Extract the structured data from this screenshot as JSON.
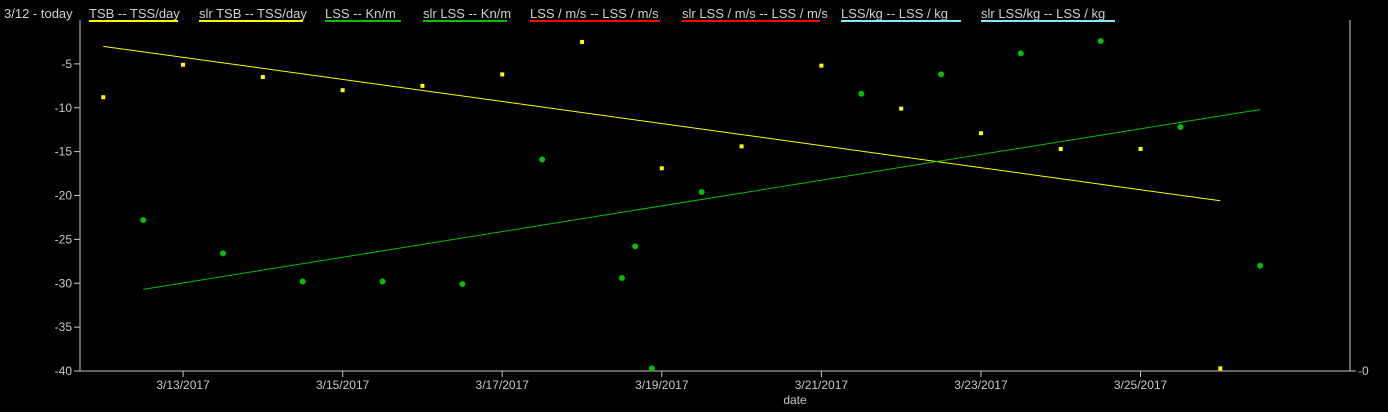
{
  "header": {
    "title": "3/12 - today"
  },
  "legend": [
    {
      "label": "TSB  -- TSS/day",
      "color": "#ffff00"
    },
    {
      "label": "slr TSB  -- TSS/day",
      "color": "#ffff00"
    },
    {
      "label": "LSS  -- Kn/m",
      "color": "#00c000"
    },
    {
      "label": "slr LSS  -- Kn/m",
      "color": "#00c000"
    },
    {
      "label": "LSS / m/s  -- LSS / m/s",
      "color": "#ff0000"
    },
    {
      "label": "slr LSS / m/s  -- LSS / m/s",
      "color": "#ff0000"
    },
    {
      "label": "LSS/kg  -- LSS / kg",
      "color": "#80e8ff"
    },
    {
      "label": "slr LSS/kg  -- LSS / kg",
      "color": "#80e8ff"
    }
  ],
  "chart_data": {
    "type": "scatter",
    "xlabel": "date",
    "ylabel": "",
    "ylim": [
      -40,
      0
    ],
    "xlim": [
      "2017-03-11T17:00",
      "2017-03-27T15:00"
    ],
    "y_ticks": [
      "-5",
      "-10",
      "-15",
      "-20",
      "-25",
      "-30",
      "-35",
      "-40"
    ],
    "right_tick": "-0",
    "x_ticks": [
      "3/13/2017",
      "3/15/2017",
      "3/17/2017",
      "3/19/2017",
      "3/21/2017",
      "3/23/2017",
      "3/25/2017"
    ],
    "series": [
      {
        "name": "TSB  -- TSS/day",
        "color": "#ffff00",
        "marker": "square",
        "points": [
          [
            "2017-03-12T00:00",
            -8.8
          ],
          [
            "2017-03-13T00:00",
            -5.1
          ],
          [
            "2017-03-14T00:00",
            -6.5
          ],
          [
            "2017-03-15T00:00",
            -8.0
          ],
          [
            "2017-03-16T00:00",
            -7.5
          ],
          [
            "2017-03-17T00:00",
            -6.2
          ],
          [
            "2017-03-18T00:00",
            -2.5
          ],
          [
            "2017-03-19T00:00",
            -16.9
          ],
          [
            "2017-03-20T00:00",
            -14.4
          ],
          [
            "2017-03-21T00:00",
            -5.2
          ],
          [
            "2017-03-22T00:00",
            -10.1
          ],
          [
            "2017-03-23T00:00",
            -12.9
          ],
          [
            "2017-03-24T00:00",
            -14.7
          ],
          [
            "2017-03-25T00:00",
            -14.7
          ],
          [
            "2017-03-26T00:00",
            -39.7
          ]
        ]
      },
      {
        "name": "slr TSB  -- TSS/day",
        "color": "#ffff00",
        "line": [
          [
            "2017-03-12T00:00",
            -3.0
          ],
          [
            "2017-03-26T00:00",
            -20.6
          ]
        ]
      },
      {
        "name": "LSS  -- Kn/m",
        "color": "#00c000",
        "marker": "dot",
        "points": [
          [
            "2017-03-12T12:00",
            -22.8
          ],
          [
            "2017-03-13T12:00",
            -26.6
          ],
          [
            "2017-03-14T12:00",
            -29.8
          ],
          [
            "2017-03-15T12:00",
            -29.8
          ],
          [
            "2017-03-16T12:00",
            -30.1
          ],
          [
            "2017-03-17T12:00",
            -15.9
          ],
          [
            "2017-03-18T12:00",
            -29.4
          ],
          [
            "2017-03-18T16:00",
            -25.8
          ],
          [
            "2017-03-18T21:00",
            -39.7
          ],
          [
            "2017-03-19T12:00",
            -19.6
          ],
          [
            "2017-03-21T12:00",
            -8.4
          ],
          [
            "2017-03-22T12:00",
            -6.2
          ],
          [
            "2017-03-23T12:00",
            -3.8
          ],
          [
            "2017-03-24T12:00",
            -2.4
          ],
          [
            "2017-03-25T12:00",
            -12.2
          ],
          [
            "2017-03-26T12:00",
            -28.0
          ]
        ]
      },
      {
        "name": "slr LSS  -- Kn/m",
        "color": "#00c000",
        "line": [
          [
            "2017-03-12T12:00",
            -30.7
          ],
          [
            "2017-03-26T12:00",
            -10.2
          ]
        ]
      }
    ]
  }
}
